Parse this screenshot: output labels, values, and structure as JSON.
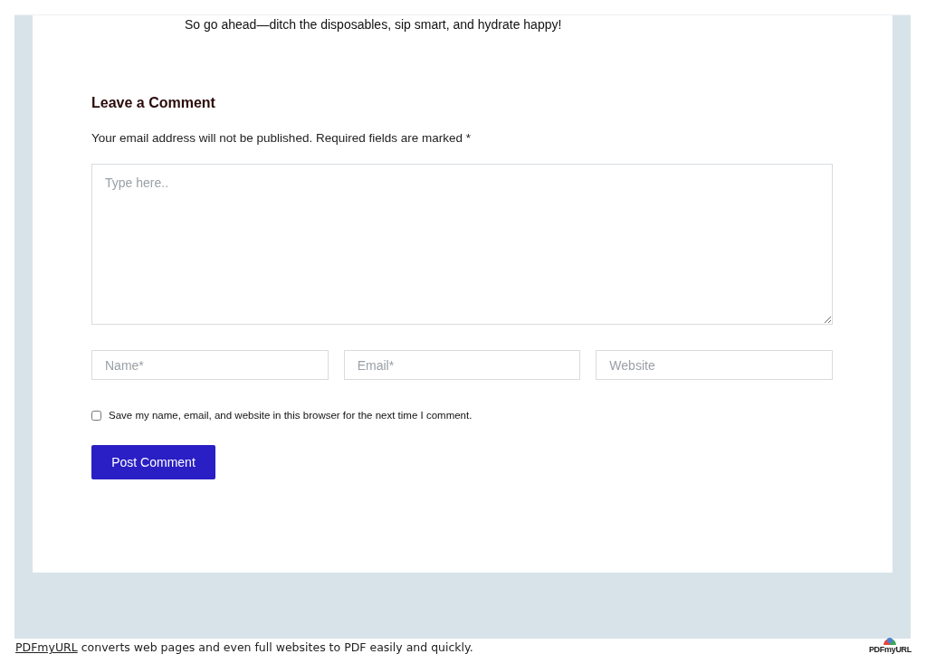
{
  "article": {
    "closing_line": "So go ahead—ditch the disposables, sip smart, and hydrate happy!"
  },
  "comment_form": {
    "title": "Leave a Comment",
    "note": "Your email address will not be published. Required fields are marked *",
    "comment": {
      "placeholder": "Type here.."
    },
    "fields": [
      {
        "placeholder": "Name*"
      },
      {
        "placeholder": "Email*"
      },
      {
        "placeholder": "Website"
      }
    ],
    "save_info": {
      "label": "Save my name, email, and website in this browser for the next time I comment.",
      "checked": false
    },
    "submit": "Post Comment"
  },
  "footer": {
    "link": "PDFmyURL",
    "text": "converts web pages and even full websites to PDF easily and quickly.",
    "logo": "PDFmyURL"
  }
}
